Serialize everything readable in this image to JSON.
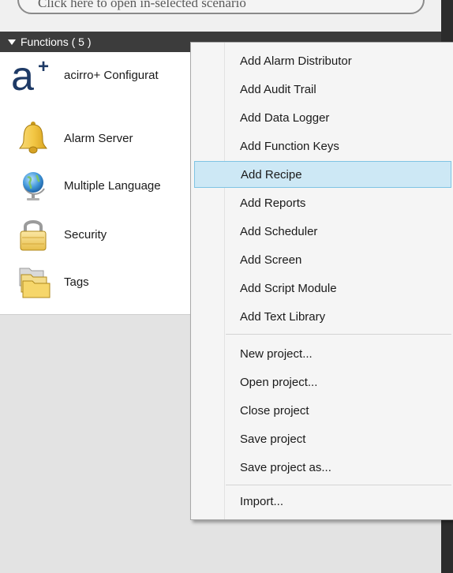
{
  "top": {
    "partial_text": "Click here to open in-selected scenario"
  },
  "panel": {
    "title": "Functions ( 5 )"
  },
  "functions": [
    {
      "label": "acirro+ Configurat",
      "icon": "acirro-plus-icon"
    },
    {
      "label": "Alarm Server",
      "icon": "bell-icon"
    },
    {
      "label": "Multiple Language",
      "icon": "globe-icon"
    },
    {
      "label": "Security",
      "icon": "padlock-icon"
    },
    {
      "label": "Tags",
      "icon": "folders-icon"
    }
  ],
  "menu": {
    "add_items": [
      "Add Alarm Distributor",
      "Add Audit Trail",
      "Add Data Logger",
      "Add Function Keys",
      "Add Recipe",
      "Add Reports",
      "Add Scheduler",
      "Add Screen",
      "Add Script Module",
      "Add Text Library"
    ],
    "project_items": [
      "New project...",
      "Open project...",
      "Close project",
      "Save project",
      "Save project as..."
    ],
    "import_label": "Import...",
    "highlighted": "Add Recipe"
  },
  "colors": {
    "header_bg": "#3c3c3c",
    "highlight_bg": "#cde8f5",
    "highlight_border": "#7fc4e3"
  }
}
